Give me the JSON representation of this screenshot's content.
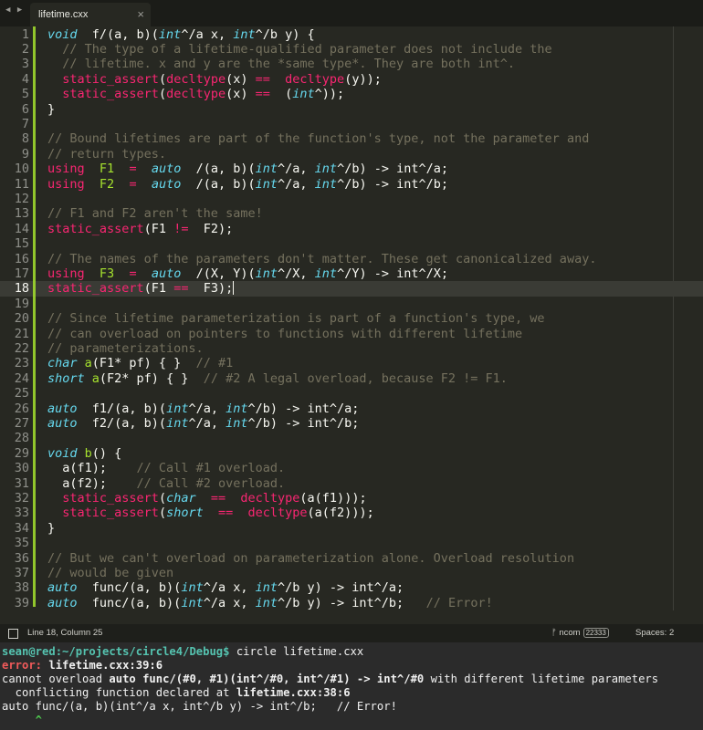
{
  "tabbar": {
    "nav_icon": "back-forward-arrows-icon",
    "nav_glyph": "◀ ▶",
    "tab": {
      "title": "lifetime.cxx",
      "close": "×"
    }
  },
  "editor": {
    "current_line": 18,
    "lines": [
      [
        [
          "kw",
          "void"
        ],
        [
          "",
          "  f/(a, b)("
        ],
        [
          "kw",
          "int"
        ],
        [
          "",
          "^/a x, "
        ],
        [
          "kw",
          "int"
        ],
        [
          "",
          "^/b y) {"
        ]
      ],
      [
        [
          "cm",
          "  // The type of a lifetime-qualified parameter does not include the"
        ]
      ],
      [
        [
          "cm",
          "  // lifetime. x and y are the *same type*. They are both int^."
        ]
      ],
      [
        [
          "",
          "  "
        ],
        [
          "rd",
          "static_assert"
        ],
        [
          "",
          "("
        ],
        [
          "rd",
          "decltype"
        ],
        [
          "",
          "(x) "
        ],
        [
          "rd",
          "=="
        ],
        [
          "",
          "  "
        ],
        [
          "rd",
          "decltype"
        ],
        [
          "",
          "(y));"
        ]
      ],
      [
        [
          "",
          "  "
        ],
        [
          "rd",
          "static_assert"
        ],
        [
          "",
          "("
        ],
        [
          "rd",
          "decltype"
        ],
        [
          "",
          "(x) "
        ],
        [
          "rd",
          "=="
        ],
        [
          "",
          "  ("
        ],
        [
          "kw",
          "int"
        ],
        [
          "",
          "^));"
        ]
      ],
      [
        [
          "",
          "}"
        ]
      ],
      [],
      [
        [
          "cm",
          "// Bound lifetimes are part of the function's type, not the parameter and"
        ]
      ],
      [
        [
          "cm",
          "// return types."
        ]
      ],
      [
        [
          "rd",
          "using"
        ],
        [
          "",
          "  "
        ],
        [
          "gn",
          "F1"
        ],
        [
          "",
          "  "
        ],
        [
          "rd",
          "="
        ],
        [
          "",
          "  "
        ],
        [
          "kw",
          "auto"
        ],
        [
          "",
          "  /(a, b)("
        ],
        [
          "kw",
          "int"
        ],
        [
          "",
          "^/a, "
        ],
        [
          "kw",
          "int"
        ],
        [
          "",
          "^/b) -> int^/a;"
        ]
      ],
      [
        [
          "rd",
          "using"
        ],
        [
          "",
          "  "
        ],
        [
          "gn",
          "F2"
        ],
        [
          "",
          "  "
        ],
        [
          "rd",
          "="
        ],
        [
          "",
          "  "
        ],
        [
          "kw",
          "auto"
        ],
        [
          "",
          "  /(a, b)("
        ],
        [
          "kw",
          "int"
        ],
        [
          "",
          "^/a, "
        ],
        [
          "kw",
          "int"
        ],
        [
          "",
          "^/b) -> int^/b;"
        ]
      ],
      [],
      [
        [
          "cm",
          "// F1 and F2 aren't the same!"
        ]
      ],
      [
        [
          "rd",
          "static_assert"
        ],
        [
          "",
          "(F1 "
        ],
        [
          "rd",
          "!="
        ],
        [
          "",
          "  F2);"
        ]
      ],
      [],
      [
        [
          "cm",
          "// The names of the parameters don't matter. These get canonicalized away."
        ]
      ],
      [
        [
          "rd",
          "using"
        ],
        [
          "",
          "  "
        ],
        [
          "gn",
          "F3"
        ],
        [
          "",
          "  "
        ],
        [
          "rd",
          "="
        ],
        [
          "",
          "  "
        ],
        [
          "kw",
          "auto"
        ],
        [
          "",
          "  /(X, Y)("
        ],
        [
          "kw",
          "int"
        ],
        [
          "",
          "^/X, "
        ],
        [
          "kw",
          "int"
        ],
        [
          "",
          "^/Y) -> int^/X;"
        ]
      ],
      [
        [
          "rd",
          "static_assert"
        ],
        [
          "",
          "(F1 "
        ],
        [
          "rd",
          "=="
        ],
        [
          "",
          "  F3);"
        ]
      ],
      [],
      [
        [
          "cm",
          "// Since lifetime parameterization is part of a function's type, we"
        ]
      ],
      [
        [
          "cm",
          "// can overload on pointers to functions with different lifetime"
        ]
      ],
      [
        [
          "cm",
          "// parameterizations."
        ]
      ],
      [
        [
          "kw",
          "char"
        ],
        [
          "",
          ""
        ],
        [
          "gn",
          " a"
        ],
        [
          "",
          "(F1* pf) { }  "
        ],
        [
          "cm",
          "// #1"
        ]
      ],
      [
        [
          "kw",
          "short"
        ],
        [
          "gn",
          " a"
        ],
        [
          "",
          "(F2* pf) { }  "
        ],
        [
          "cm",
          "// #2 A legal overload, because F2 != F1."
        ]
      ],
      [],
      [
        [
          "kw",
          "auto"
        ],
        [
          "",
          "  f1/(a, b)("
        ],
        [
          "kw",
          "int"
        ],
        [
          "",
          "^/a, "
        ],
        [
          "kw",
          "int"
        ],
        [
          "",
          "^/b) -> int^/a;"
        ]
      ],
      [
        [
          "kw",
          "auto"
        ],
        [
          "",
          "  f2/(a, b)("
        ],
        [
          "kw",
          "int"
        ],
        [
          "",
          "^/a, "
        ],
        [
          "kw",
          "int"
        ],
        [
          "",
          "^/b) -> int^/b;"
        ]
      ],
      [],
      [
        [
          "kw",
          "void"
        ],
        [
          "gn",
          " b"
        ],
        [
          "",
          "() {"
        ]
      ],
      [
        [
          "",
          "  a(f1);    "
        ],
        [
          "cm",
          "// Call #1 overload."
        ]
      ],
      [
        [
          "",
          "  a(f2);    "
        ],
        [
          "cm",
          "// Call #2 overload."
        ]
      ],
      [
        [
          "",
          "  "
        ],
        [
          "rd",
          "static_assert"
        ],
        [
          "",
          "("
        ],
        [
          "kw",
          "char"
        ],
        [
          "",
          "  "
        ],
        [
          "rd",
          "=="
        ],
        [
          "",
          "  "
        ],
        [
          "rd",
          "decltype"
        ],
        [
          "",
          "(a(f1)));"
        ]
      ],
      [
        [
          "",
          "  "
        ],
        [
          "rd",
          "static_assert"
        ],
        [
          "",
          "("
        ],
        [
          "kw",
          "short"
        ],
        [
          "",
          "  "
        ],
        [
          "rd",
          "=="
        ],
        [
          "",
          "  "
        ],
        [
          "rd",
          "decltype"
        ],
        [
          "",
          "(a(f2)));"
        ]
      ],
      [
        [
          "",
          "}"
        ]
      ],
      [],
      [
        [
          "cm",
          "// But we can't overload on parameterization alone. Overload resolution"
        ]
      ],
      [
        [
          "cm",
          "// would be given"
        ]
      ],
      [
        [
          "kw",
          "auto"
        ],
        [
          "",
          "  func/(a, b)("
        ],
        [
          "kw",
          "int"
        ],
        [
          "",
          "^/a x, "
        ],
        [
          "kw",
          "int"
        ],
        [
          "",
          "^/b y) -> int^/a;"
        ]
      ],
      [
        [
          "kw",
          "auto"
        ],
        [
          "",
          "  func/(a, b)("
        ],
        [
          "kw",
          "int"
        ],
        [
          "",
          "^/a x, "
        ],
        [
          "kw",
          "int"
        ],
        [
          "",
          "^/b y) -> int^/b;   "
        ],
        [
          "cm",
          "// Error!"
        ]
      ]
    ]
  },
  "statusbar": {
    "panel_icon": "panel-toggle-icon",
    "cursor_position": "Line 18, Column 25",
    "branch_icon": "git-branch-icon",
    "branch_glyph": "ᚠ",
    "branch_name": "ncom",
    "branch_count": "22333",
    "indentation": "Spaces: 2"
  },
  "terminal": {
    "prompt": "sean@red:~/projects/circle4/Debug$",
    "command": " circle lifetime.cxx",
    "error_label": "error:",
    "error_location": " lifetime.cxx:39:6",
    "msg_a": "cannot overload ",
    "msg_b": "auto func/(#0, #1)(int^/#0, int^/#1) -> int^/#0",
    "msg_c": " with different lifetime parameters",
    "conflict_a": "  conflicting function declared at ",
    "conflict_b": "lifetime.cxx:38:6",
    "source_line": "auto func/(a, b)(int^/a x, int^/b y) -> int^/b;   // Error!",
    "caret": "     ^"
  }
}
